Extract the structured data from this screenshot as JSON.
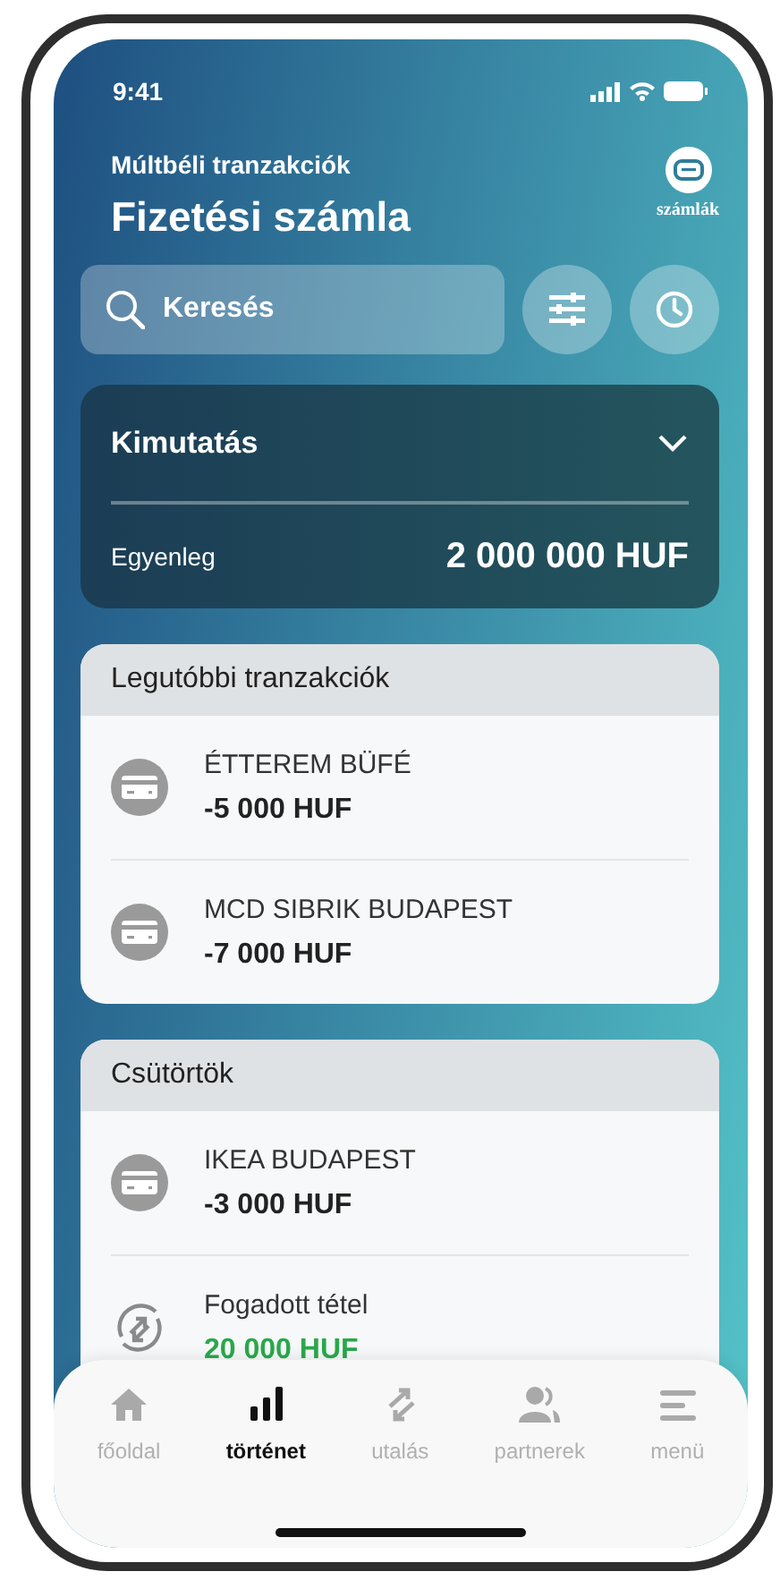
{
  "status_bar": {
    "time": "9:41"
  },
  "header": {
    "subtitle": "Múltbéli tranzakciók",
    "title": "Fizetési számla",
    "accounts_label": "számlák"
  },
  "search": {
    "placeholder": "Keresés"
  },
  "statement": {
    "title": "Kimutatás",
    "expanded": false,
    "balance_label": "Egyenleg",
    "balance": "2 000 000 HUF"
  },
  "sections": [
    {
      "title": "Legutóbbi tranzakciók",
      "transactions": [
        {
          "kind": "card",
          "name": "ÉTTEREM BÜFÉ",
          "amount": "-5 000 HUF"
        },
        {
          "kind": "card",
          "name": "MCD SIBRIK BUDAPEST",
          "amount": "-7 000 HUF"
        }
      ]
    },
    {
      "title": "Csütörtök",
      "transactions": [
        {
          "kind": "card",
          "name": "IKEA BUDAPEST",
          "amount": "-3 000 HUF"
        },
        {
          "kind": "received",
          "name": "Fogadott tétel",
          "amount": "20 000 HUF"
        }
      ]
    }
  ],
  "nav": [
    {
      "kind": "home",
      "label": "főoldal",
      "selected": false
    },
    {
      "kind": "history",
      "label": "történet",
      "selected": true
    },
    {
      "kind": "transfer",
      "label": "utalás",
      "selected": false
    },
    {
      "kind": "partners",
      "label": "partnerek",
      "selected": false
    },
    {
      "kind": "menu",
      "label": "menü",
      "selected": false
    }
  ]
}
